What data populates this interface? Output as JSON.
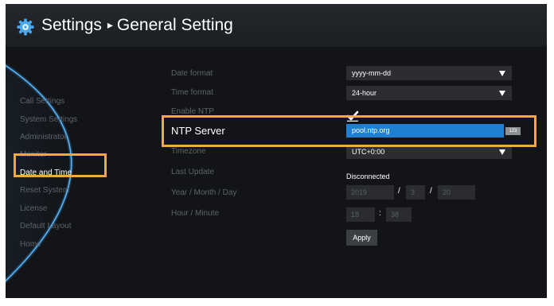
{
  "header": {
    "title": "Settings",
    "arrow": "▸",
    "subtitle": "General Setting",
    "icon": "gear-icon"
  },
  "sidebar": {
    "items": [
      {
        "label": "Call Settings",
        "active": false
      },
      {
        "label": "System Settings",
        "active": false
      },
      {
        "label": "Administrator",
        "active": false
      },
      {
        "label": "Monitor",
        "active": false
      },
      {
        "label": "Date and Time",
        "active": true
      },
      {
        "label": "Reset System",
        "active": false
      },
      {
        "label": "License",
        "active": false
      },
      {
        "label": "Default Layout",
        "active": false
      },
      {
        "label": "Home",
        "active": false
      }
    ]
  },
  "form": {
    "date_format": {
      "label": "Date format",
      "value": "yyyy-mm-dd"
    },
    "time_format": {
      "label": "Time format",
      "value": "24-hour"
    },
    "enable_ntp": {
      "label": "Enable NTP",
      "checked": true
    },
    "ntp_server": {
      "label": "NTP Server",
      "value": "pool.ntp.org",
      "badge": "123"
    },
    "timezone": {
      "label": "Timezone",
      "value": "UTC+0:00"
    },
    "last_update": {
      "label": "Last Update",
      "value": "Disconnected"
    },
    "date": {
      "label": "Year / Month / Day",
      "year": "2019",
      "month": "3",
      "day": "20",
      "separator": "/"
    },
    "time": {
      "label": "Hour / Minute",
      "hour": "18",
      "minute": "38",
      "separator": ":"
    },
    "apply_label": "Apply"
  },
  "colors": {
    "highlight": "#f2a93b",
    "accent": "#1f7fd2",
    "background": "#121417"
  }
}
